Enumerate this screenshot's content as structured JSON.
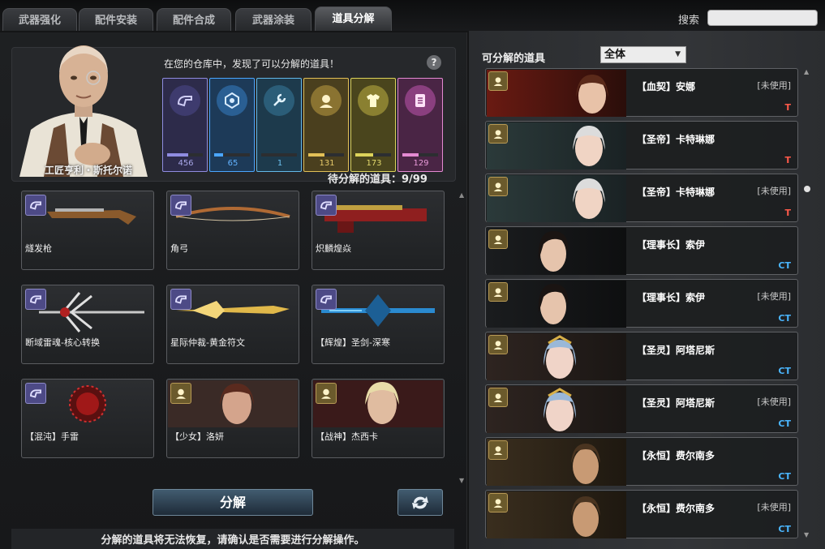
{
  "tabs": [
    {
      "label": "武器强化",
      "active": false
    },
    {
      "label": "配件安装",
      "active": false
    },
    {
      "label": "配件合成",
      "active": false
    },
    {
      "label": "武器涂装",
      "active": false
    },
    {
      "label": "道具分解",
      "active": true
    }
  ],
  "search": {
    "label": "搜索",
    "value": ""
  },
  "npc": {
    "name": "工匠亨利・斯托尔诺"
  },
  "info": {
    "found_text": "在您的仓库中，发现了可以分解的道具！",
    "help_icon": "?"
  },
  "stats": [
    {
      "icon": "pistol-icon",
      "value": "456",
      "color": "#8f8ce0",
      "fill": 0.6
    },
    {
      "icon": "gear-badge-icon",
      "value": "65",
      "color": "#4aa6ff",
      "fill": 0.25
    },
    {
      "icon": "wrench-icon",
      "value": "1",
      "color": "#63b8e8",
      "fill": 0.0
    },
    {
      "icon": "person-icon",
      "value": "131",
      "color": "#e2c057",
      "fill": 0.45
    },
    {
      "icon": "shirt-icon",
      "value": "173",
      "color": "#ddd35a",
      "fill": 0.5
    },
    {
      "icon": "document-icon",
      "value": "129",
      "color": "#e48ad2",
      "fill": 0.45
    }
  ],
  "pending": {
    "label": "待分解的道具：9/99"
  },
  "pending_items": [
    {
      "name": "燧发枪",
      "type": "weapon"
    },
    {
      "name": "角弓",
      "type": "weapon"
    },
    {
      "name": "炽麟煌焱",
      "type": "weapon"
    },
    {
      "name": "断域雷魂-核心转换",
      "type": "weapon"
    },
    {
      "name": "星际仲裁-黄金符文",
      "type": "weapon"
    },
    {
      "name": "【辉煌】圣剑-深寒",
      "type": "weapon"
    },
    {
      "name": "【混沌】手雷",
      "type": "weapon"
    },
    {
      "name": "【少女】洛妍",
      "type": "character"
    },
    {
      "name": "【战神】杰西卡",
      "type": "character"
    }
  ],
  "buttons": {
    "decompose": "分解",
    "refresh_icon": "refresh-icon"
  },
  "warning": "分解的道具将无法恢复，请确认是否需要进行分解操作。",
  "right": {
    "title": "可分解的道具",
    "filter": "全体",
    "items": [
      {
        "name": "【血契】安娜",
        "status": "[未使用]",
        "team": "T"
      },
      {
        "name": "【圣帝】卡特琳娜",
        "status": "",
        "team": "T"
      },
      {
        "name": "【圣帝】卡特琳娜",
        "status": "[未使用]",
        "team": "T"
      },
      {
        "name": "【理事长】索伊",
        "status": "",
        "team": "CT"
      },
      {
        "name": "【理事长】索伊",
        "status": "[未使用]",
        "team": "CT"
      },
      {
        "name": "【圣灵】阿塔尼斯",
        "status": "",
        "team": "CT"
      },
      {
        "name": "【圣灵】阿塔尼斯",
        "status": "[未使用]",
        "team": "CT"
      },
      {
        "name": "【永恒】费尔南多",
        "status": "",
        "team": "CT"
      },
      {
        "name": "【永恒】费尔南多",
        "status": "[未使用]",
        "team": "CT"
      }
    ]
  }
}
